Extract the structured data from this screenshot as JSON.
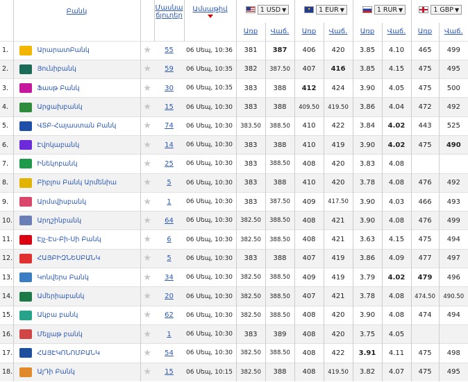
{
  "header": {
    "bank": "Բանկ",
    "branches_line1": "Մասնա",
    "branches_line2": "ճյուղեր",
    "date": "Ամսաթիվ",
    "currencies": [
      {
        "code": "1 USD",
        "flag": "us-flag"
      },
      {
        "code": "1 EUR",
        "flag": "eu-flag"
      },
      {
        "code": "1 RUR",
        "flag": "ru-flag"
      },
      {
        "code": "1 GBP",
        "flag": "gb-flag"
      }
    ],
    "buy": "Առք",
    "sell": "Վաճ."
  },
  "rows": [
    {
      "n": "1.",
      "bank": "ԱրարատԲանկ",
      "logo": "#f2b600",
      "branches": "55",
      "time": "06 Սեպ, 10:36",
      "usd": [
        "381",
        "387"
      ],
      "eur": [
        "406",
        "420"
      ],
      "rur": [
        "3.85",
        "4.10"
      ],
      "gbp": [
        "465",
        "499"
      ]
    },
    {
      "n": "2.",
      "bank": "Յունիբանկ",
      "logo": "#1a6b57",
      "branches": "59",
      "time": "06 Սեպ, 10:35",
      "usd": [
        "382",
        "387.50"
      ],
      "eur": [
        "407",
        "416"
      ],
      "rur": [
        "3.85",
        "4.15"
      ],
      "gbp": [
        "475",
        "495"
      ]
    },
    {
      "n": "3.",
      "bank": "Ֆասթ Բանկ",
      "logo": "#c6189c",
      "branches": "30",
      "time": "06 Սեպ, 10:35",
      "usd": [
        "383",
        "388"
      ],
      "eur": [
        "412",
        "424"
      ],
      "rur": [
        "3.90",
        "4.05"
      ],
      "gbp": [
        "475",
        "500"
      ]
    },
    {
      "n": "4.",
      "bank": "Արցախբանկ",
      "logo": "#2e8b3c",
      "branches": "15",
      "time": "06 Սեպ, 10:30",
      "usd": [
        "383",
        "388"
      ],
      "eur": [
        "409.50",
        "419.50"
      ],
      "rur": [
        "3.86",
        "4.04"
      ],
      "gbp": [
        "472",
        "492"
      ]
    },
    {
      "n": "5.",
      "bank": "ՎՏԲ-Հայաստան Բանկ",
      "logo": "#1f4fa8",
      "branches": "74",
      "time": "06 Սեպ, 10:30",
      "usd": [
        "383.50",
        "388.50"
      ],
      "eur": [
        "410",
        "422"
      ],
      "rur": [
        "3.84",
        "4.02"
      ],
      "gbp": [
        "443",
        "525"
      ]
    },
    {
      "n": "6.",
      "bank": "Էվոկաբանկ",
      "logo": "#6c2bd9",
      "branches": "14",
      "time": "06 Սեպ, 10:30",
      "usd": [
        "383",
        "388"
      ],
      "eur": [
        "410",
        "419"
      ],
      "rur": [
        "3.90",
        "4.02"
      ],
      "gbp": [
        "475",
        "490"
      ]
    },
    {
      "n": "7.",
      "bank": "Ինեկոբանկ",
      "logo": "#1e9a4a",
      "branches": "25",
      "time": "06 Սեպ, 10:30",
      "usd": [
        "383",
        "388.50"
      ],
      "eur": [
        "408",
        "420"
      ],
      "rur": [
        "3.83",
        "4.08"
      ],
      "gbp": [
        "",
        ""
      ]
    },
    {
      "n": "8.",
      "bank": "Բիբլոս Բանկ Արմենիա",
      "logo": "#e2b300",
      "branches": "5",
      "time": "06 Սեպ, 10:30",
      "usd": [
        "383",
        "388"
      ],
      "eur": [
        "410",
        "420"
      ],
      "rur": [
        "3.78",
        "4.08"
      ],
      "gbp": [
        "476",
        "492"
      ]
    },
    {
      "n": "9.",
      "bank": "Արմսվիսբանկ",
      "logo": "#d9486b",
      "branches": "1",
      "time": "06 Սեպ, 10:30",
      "usd": [
        "383",
        "387.50"
      ],
      "eur": [
        "409",
        "417.50"
      ],
      "rur": [
        "3.90",
        "4.03"
      ],
      "gbp": [
        "466",
        "493"
      ]
    },
    {
      "n": "10.",
      "bank": "Արդշինբանկ",
      "logo": "#6a7fb7",
      "branches": "64",
      "time": "06 Սեպ, 10:30",
      "usd": [
        "382.50",
        "388.50"
      ],
      "eur": [
        "408",
        "421"
      ],
      "rur": [
        "3.90",
        "4.08"
      ],
      "gbp": [
        "476",
        "499"
      ]
    },
    {
      "n": "11.",
      "bank": "Էյչ-Էս-Բի-Սի Բանկ",
      "logo": "#db0011",
      "branches": "6",
      "time": "06 Սեպ, 10:30",
      "usd": [
        "382.50",
        "388.50"
      ],
      "eur": [
        "408",
        "421"
      ],
      "rur": [
        "3.63",
        "4.15"
      ],
      "gbp": [
        "475",
        "494"
      ]
    },
    {
      "n": "12.",
      "bank": "ՀԱՅԲԻԶՆԵՍԲԱՆԿ",
      "logo": "#e03030",
      "branches": "5",
      "time": "06 Սեպ, 10:30",
      "usd": [
        "383",
        "388"
      ],
      "eur": [
        "407",
        "419"
      ],
      "rur": [
        "3.86",
        "4.09"
      ],
      "gbp": [
        "477",
        "497"
      ]
    },
    {
      "n": "13.",
      "bank": "Կոնվերս Բանկ",
      "logo": "#3b7dc4",
      "branches": "34",
      "time": "06 Սեպ, 10:30",
      "usd": [
        "382.50",
        "388.50"
      ],
      "eur": [
        "409",
        "419"
      ],
      "rur": [
        "3.79",
        "4.02"
      ],
      "gbp": [
        "479",
        "496"
      ]
    },
    {
      "n": "14.",
      "bank": "Ամերիաբանկ",
      "logo": "#1c7a46",
      "branches": "20",
      "time": "06 Սեպ, 10:30",
      "usd": [
        "382.50",
        "388.50"
      ],
      "eur": [
        "407",
        "421"
      ],
      "rur": [
        "3.78",
        "4.08"
      ],
      "gbp": [
        "474.50",
        "490.50"
      ]
    },
    {
      "n": "15.",
      "bank": "Ակբա բանկ",
      "logo": "#27a28b",
      "branches": "62",
      "time": "06 Սեպ, 10:30",
      "usd": [
        "382.50",
        "388.50"
      ],
      "eur": [
        "408",
        "420"
      ],
      "rur": [
        "3.90",
        "4.08"
      ],
      "gbp": [
        "474",
        "494"
      ]
    },
    {
      "n": "16.",
      "bank": "Մելլաթ բանկ",
      "logo": "#d24545",
      "branches": "1",
      "time": "06 Սեպ, 10:30",
      "usd": [
        "383",
        "389"
      ],
      "eur": [
        "408",
        "420"
      ],
      "rur": [
        "3.75",
        "4.05"
      ],
      "gbp": [
        "",
        ""
      ]
    },
    {
      "n": "17.",
      "bank": "ՀԱՅԷԿՈՆՈՄԲԱՆԿ",
      "logo": "#1d4f9c",
      "branches": "54",
      "time": "06 Սեպ, 10:30",
      "usd": [
        "382.50",
        "388.50"
      ],
      "eur": [
        "408",
        "422"
      ],
      "rur": [
        "3.91",
        "4.11"
      ],
      "gbp": [
        "475",
        "498"
      ]
    },
    {
      "n": "18.",
      "bank": "ԱյԴի Բանկ",
      "logo": "#e08a2c",
      "branches": "15",
      "time": "06 Սեպ, 10:15",
      "usd": [
        "382.50",
        "388"
      ],
      "eur": [
        "408",
        "419.50"
      ],
      "rur": [
        "3.82",
        "4.07"
      ],
      "gbp": [
        "475",
        "495"
      ]
    }
  ]
}
